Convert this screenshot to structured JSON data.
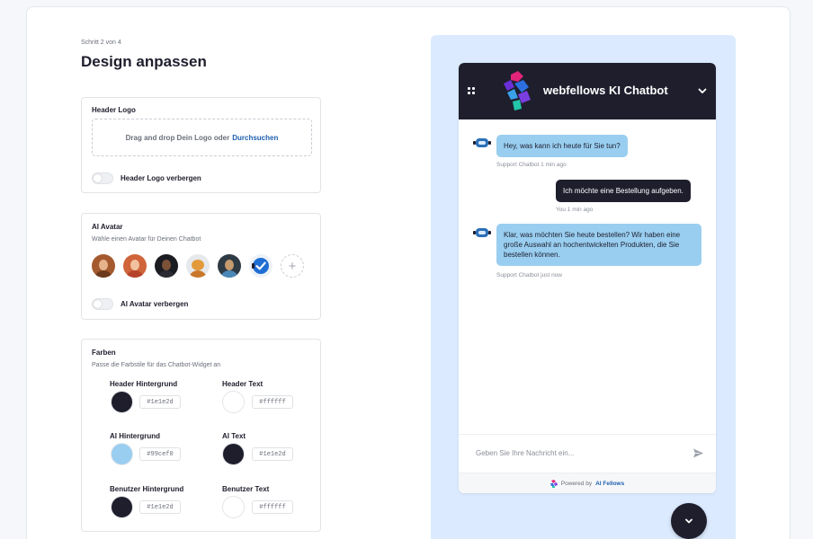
{
  "page": {
    "step": "Schritt 2 von 4",
    "title": "Design anpassen"
  },
  "header_logo": {
    "title": "Header Logo",
    "drop_text": "Drag and drop Dein Logo oder",
    "browse_link": "Durchsuchen",
    "hide_label": "Header Logo verbergen",
    "hide_enabled": false
  },
  "ai_avatar": {
    "title": "AI Avatar",
    "subtitle": "Wähle einen Avatar für Deinen Chatbot",
    "avatars": [
      "avatar-woman-brown-hair",
      "avatar-woman-red-hair",
      "avatar-man-dark",
      "avatar-robot-owl",
      "avatar-robot-boy",
      "avatar-check-bot"
    ],
    "selected_avatar": "avatar-check-bot",
    "add_icon": "plus-icon",
    "hide_label": "AI Avatar verbergen",
    "hide_enabled": false
  },
  "colors": {
    "title": "Farben",
    "subtitle": "Passe die Farbstile für das Chatbot-Widget an",
    "header_bg": {
      "label": "Header Hintergrund",
      "value": "#1e1e2d"
    },
    "header_text": {
      "label": "Header Text",
      "value": "#ffffff"
    },
    "ai_bg": {
      "label": "AI Hintergrund",
      "value": "#99cef0"
    },
    "ai_text": {
      "label": "AI Text",
      "value": "#1e1e2d"
    },
    "user_bg": {
      "label": "Benutzer Hintergrund",
      "value": "#1e1e2d"
    },
    "user_text": {
      "label": "Benutzer Text",
      "value": "#ffffff"
    }
  },
  "preview": {
    "bot_title": "webfellows KI Chatbot",
    "messages": [
      {
        "from": "ai",
        "text": "Hey, was kann ich heute für Sie tun?",
        "meta": "Support Chatbot 1 min ago"
      },
      {
        "from": "user",
        "text": "Ich möchte eine Bestellung aufgeben.",
        "meta": "You 1 min ago"
      },
      {
        "from": "ai",
        "text": "Klar, was möchten Sie heute bestellen? Wir haben eine große Auswahl an hochentwickelten Produkten, die Sie bestellen können.",
        "meta": "Support Chatbot just now"
      }
    ],
    "input_placeholder": "Geben Sie Ihre Nachricht ein...",
    "powered_prefix": "Powered by",
    "powered_brand": "AI Fellows"
  }
}
